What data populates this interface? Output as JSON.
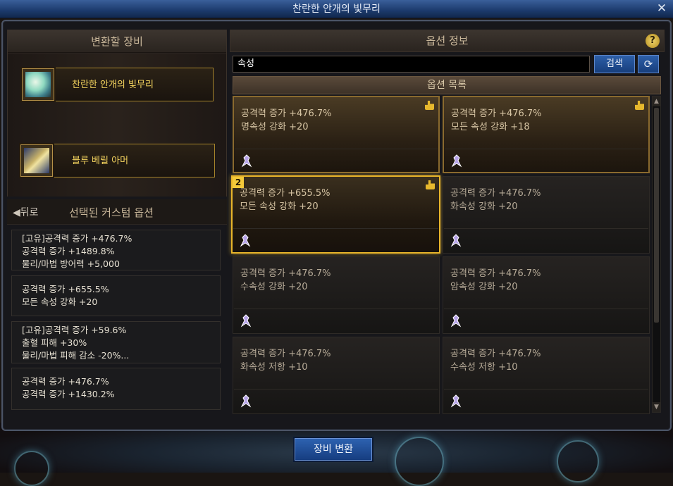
{
  "window": {
    "title": "찬란한 안개의 빛무리"
  },
  "left": {
    "header": "변환할 장비",
    "source_item": "찬란한 안개의 빛무리",
    "target_item": "블루 베릴 아머",
    "back_label": "◀뒤로",
    "selected_header": "선택된 커스텀 옵션",
    "selected_options": [
      {
        "lines": [
          "[고유]공격력 증가 +476.7%",
          "공격력 증가 +1489.8%",
          "물리/마법 방어력 +5,000"
        ]
      },
      {
        "lines": [
          "공격력 증가 +655.5%",
          "모든 속성 강화 +20"
        ]
      },
      {
        "lines": [
          "[고유]공격력 증가 +59.6%",
          "출혈 피해 +30%",
          "물리/마법 피해 감소 -20%..."
        ]
      },
      {
        "lines": [
          "공격력 증가 +476.7%",
          "공격력 증가 +1430.2%"
        ]
      }
    ]
  },
  "right": {
    "header": "옵션 정보",
    "help": "?",
    "search_value": "속성",
    "search_button": "검색",
    "refresh_icon": "⟳",
    "list_header": "옵션 목록",
    "options": [
      {
        "l1": "공격력 증가 +476.7%",
        "l2": "명속성 강화 +20",
        "state": "highlight",
        "thumb": true
      },
      {
        "l1": "공격력 증가 +476.7%",
        "l2": "모든 속성 강화 +18",
        "state": "highlight",
        "thumb": true
      },
      {
        "l1": "공격력 증가 +655.5%",
        "l2": "모든 속성 강화 +20",
        "state": "selected",
        "thumb": true,
        "badge": "2"
      },
      {
        "l1": "공격력 증가 +476.7%",
        "l2": "화속성 강화 +20",
        "state": "normal"
      },
      {
        "l1": "공격력 증가 +476.7%",
        "l2": "수속성 강화 +20",
        "state": "normal"
      },
      {
        "l1": "공격력 증가 +476.7%",
        "l2": "암속성 강화 +20",
        "state": "normal"
      },
      {
        "l1": "공격력 증가 +476.7%",
        "l2": "화속성 저항 +10",
        "state": "normal"
      },
      {
        "l1": "공격력 증가 +476.7%",
        "l2": "수속성 저항 +10",
        "state": "normal"
      }
    ]
  },
  "footer": {
    "convert_button": "장비 변환"
  },
  "icons": {
    "close": "close-icon",
    "arrow": "down-arrow-icon",
    "thumb": "thumbs-up-icon",
    "char": "character-icon"
  },
  "colors": {
    "gold": "#f2d25e",
    "blue_button": "#2d5fa8",
    "selected_border": "#e8b52a"
  }
}
